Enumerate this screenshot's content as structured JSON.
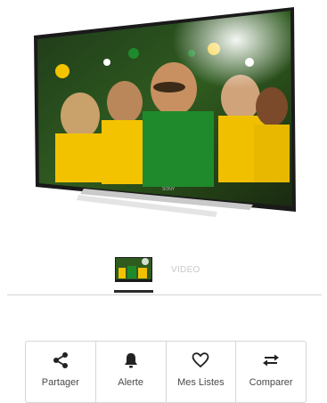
{
  "product": {
    "image_alt": "Sony LED TV",
    "brand_mark": "SONY"
  },
  "gallery": {
    "tabs": [
      {
        "type": "image",
        "active": true
      },
      {
        "type": "video",
        "label": "VIDEO",
        "active": false
      }
    ]
  },
  "actions": [
    {
      "icon": "share-icon",
      "label": "Partager"
    },
    {
      "icon": "bell-icon",
      "label": "Alerte"
    },
    {
      "icon": "heart-icon",
      "label": "Mes Listes"
    },
    {
      "icon": "compare-arrows-icon",
      "label": "Comparer"
    }
  ],
  "colors": {
    "accent_dark": "#2b2b2b",
    "muted": "#c8c8c8",
    "border": "#d6d6d6"
  }
}
